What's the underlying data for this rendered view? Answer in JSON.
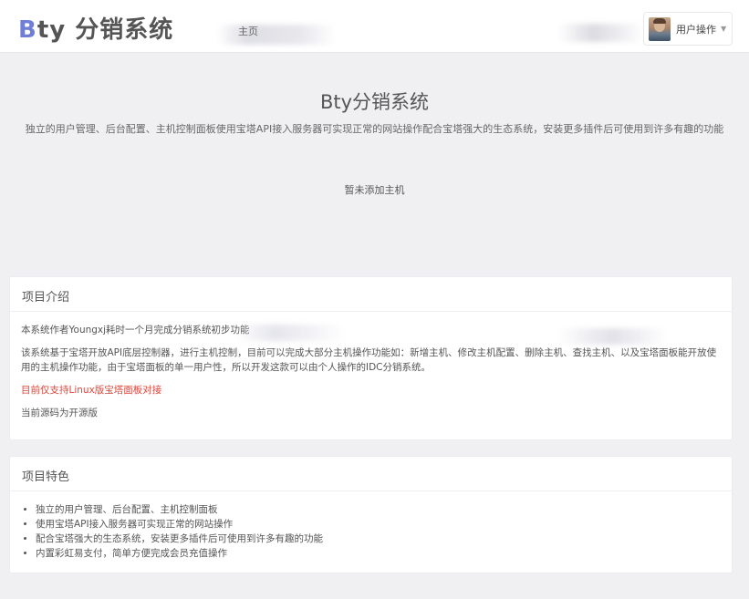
{
  "header": {
    "brand_prefix": "B",
    "brand_rest": "ty 分销系统",
    "nav_home": "主页",
    "user_menu_label": "用户操作",
    "caret_glyph": "▼"
  },
  "hero": {
    "title": "Bty分销系统",
    "subtitle": "独立的用户管理、后台配置、主机控制面板使用宝塔API接入服务器可实现正常的网站操作配合宝塔强大的生态系统，安装更多插件后可使用到许多有趣的功能",
    "empty_message": "暂未添加主机"
  },
  "intro": {
    "heading": "项目介绍",
    "paragraphs": [
      "本系统作者Youngxj耗时一个月完成分销系统初步功能",
      "该系统基于宝塔开放API底层控制器，进行主机控制，目前可以完成大部分主机操作功能如：新增主机、修改主机配置、删除主机、查找主机、以及宝塔面板能开放使用的主机操作功能，由于宝塔面板的单一用户性，所以开发这款可以由个人操作的IDC分销系统。",
      "目前仅支持Linux版宝塔面板对接",
      "当前源码为开源版"
    ]
  },
  "features": {
    "heading": "项目特色",
    "items": [
      "独立的用户管理、后台配置、主机控制面板",
      "使用宝塔API接入服务器可实现正常的网站操作",
      "配合宝塔强大的生态系统，安装更多插件后可使用到许多有趣的功能",
      "内置彩虹易支付，简单方便完成会员充值操作"
    ]
  },
  "colors": {
    "brand_accent": "#6f7fd6",
    "warning_text": "#e0463c",
    "background": "#f0f0f3"
  }
}
